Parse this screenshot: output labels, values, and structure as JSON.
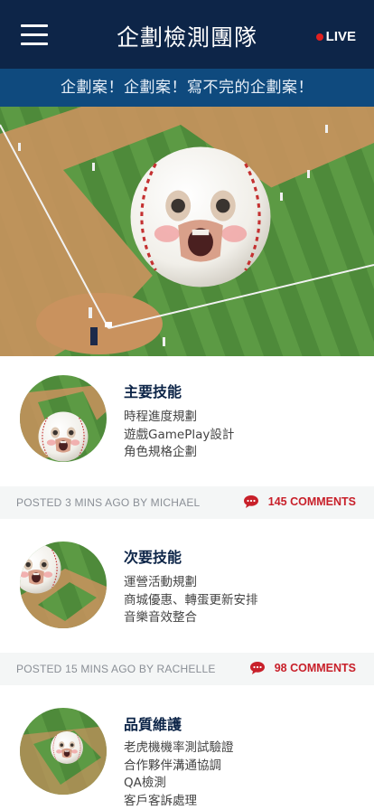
{
  "header": {
    "title": "企劃檢測團隊",
    "live_label": "LIVE",
    "menu_icon": "hamburger-menu-icon",
    "live_dot_color": "#e02020",
    "bg_color": "#0d2548"
  },
  "ticker": {
    "text": "企劃案！企劃案！寫不完的企劃案！"
  },
  "hero": {
    "image": "baseball-field-with-face-ball"
  },
  "posts": [
    {
      "title": "主要技能",
      "lines": [
        "時程進度規劃",
        "遊戲GamePlay設計",
        "角色規格企劃"
      ],
      "meta": "POSTED 3 MINS AGO BY MICHAEL",
      "comments": "145 COMMENTS"
    },
    {
      "title": "次要技能",
      "lines": [
        "運營活動規劃",
        "商城優惠、轉蛋更新安排",
        "音樂音效整合"
      ],
      "meta": "POSTED 15 MINS AGO BY RACHELLE",
      "comments": "98 COMMENTS"
    },
    {
      "title": "品質維護",
      "lines": [
        "老虎機機率測試驗證",
        "合作夥伴溝通協調",
        "QA檢測",
        "客戶客訴處理"
      ]
    }
  ],
  "colors": {
    "accent": "#c8202a",
    "ticker_bg": "#0f4a7e"
  }
}
